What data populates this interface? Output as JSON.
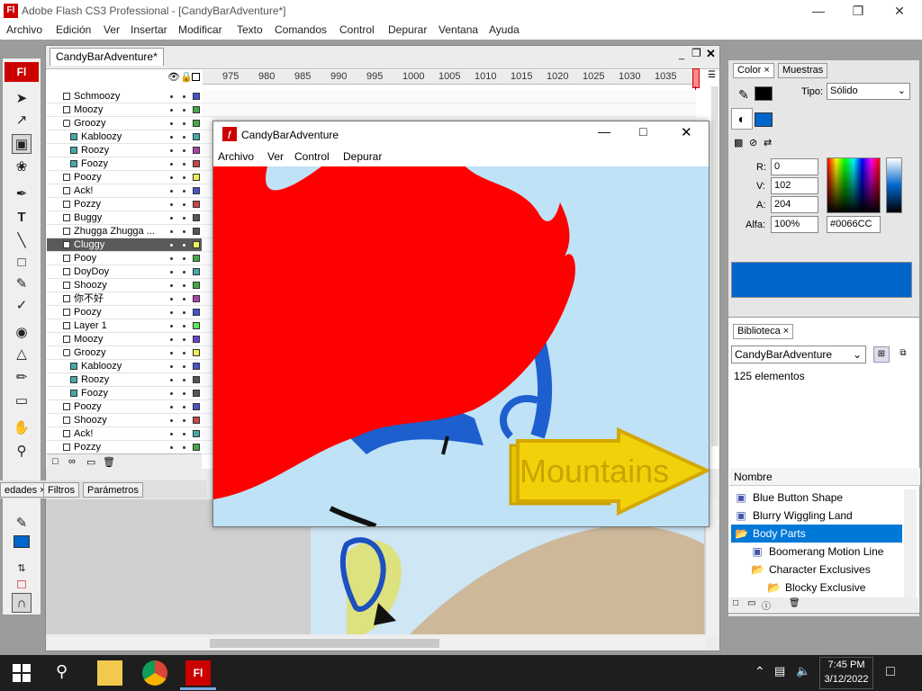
{
  "window": {
    "title": "Adobe Flash CS3 Professional - [CandyBarAdventure*]"
  },
  "menu": [
    "Archivo",
    "Edición",
    "Ver",
    "Insertar",
    "Modificar",
    "Texto",
    "Comandos",
    "Control",
    "Depurar",
    "Ventana",
    "Ayuda"
  ],
  "document": {
    "tab": "CandyBarAdventure*"
  },
  "ruler": [
    "975",
    "980",
    "985",
    "990",
    "995",
    "1000",
    "1005",
    "1010",
    "1015",
    "1020",
    "1025",
    "1030",
    "1035"
  ],
  "layers": [
    {
      "name": "Schmoozy",
      "type": "layer",
      "color": "#4455cc"
    },
    {
      "name": "Moozy",
      "type": "layer",
      "color": "#44aa44"
    },
    {
      "name": "Groozy",
      "type": "guide",
      "color": "#44aa44"
    },
    {
      "name": "Kabloozy",
      "type": "guided",
      "color": "#44aaaa"
    },
    {
      "name": "Roozy",
      "type": "guided",
      "color": "#aa44aa"
    },
    {
      "name": "Foozy",
      "type": "guided",
      "color": "#cc4444"
    },
    {
      "name": "Poozy",
      "type": "layer",
      "color": "#eeee55"
    },
    {
      "name": "Ack!",
      "type": "layer",
      "color": "#4455cc"
    },
    {
      "name": "Pozzy",
      "type": "layer",
      "color": "#cc4444"
    },
    {
      "name": "Buggy",
      "type": "layer",
      "color": "#555555"
    },
    {
      "name": "Zhugga Zhugga ...",
      "type": "layer",
      "color": "#555555"
    },
    {
      "name": "Cluggy",
      "type": "layer",
      "color": "#eeee55",
      "selected": true
    },
    {
      "name": "Pooy",
      "type": "layer",
      "color": "#44aa44"
    },
    {
      "name": "DoyDoy",
      "type": "layer",
      "color": "#44aaaa"
    },
    {
      "name": "Shoozy",
      "type": "layer",
      "color": "#44aa44"
    },
    {
      "name": "你不好",
      "type": "layer",
      "color": "#aa44aa"
    },
    {
      "name": "Poozy",
      "type": "layer",
      "color": "#4455cc"
    },
    {
      "name": "Layer 1",
      "type": "layer",
      "color": "#55ee55"
    },
    {
      "name": "Moozy",
      "type": "layer",
      "color": "#6644cc"
    },
    {
      "name": "Groozy",
      "type": "guide",
      "color": "#eeee55"
    },
    {
      "name": "Kabloozy",
      "type": "guided",
      "color": "#4455cc"
    },
    {
      "name": "Roozy",
      "type": "guided",
      "color": "#555555"
    },
    {
      "name": "Foozy",
      "type": "guided",
      "color": "#555555"
    },
    {
      "name": "Poozy",
      "type": "layer",
      "color": "#4455cc"
    },
    {
      "name": "Shoozy",
      "type": "layer",
      "color": "#cc4444"
    },
    {
      "name": "Ack!",
      "type": "layer",
      "color": "#44aaaa"
    },
    {
      "name": "Pozzy",
      "type": "layer",
      "color": "#44aa44"
    }
  ],
  "props_tabs": [
    "edades",
    "Filtros",
    "Parámetros"
  ],
  "color_panel": {
    "tabs": [
      "Color",
      "Muestras"
    ],
    "tipo_label": "Tipo:",
    "tipo_value": "Sólido",
    "r_label": "R:",
    "r": "0",
    "v_label": "V:",
    "v": "102",
    "a_label": "A:",
    "a": "204",
    "alfa_label": "Alfa:",
    "alfa": "100%",
    "hex": "#0066CC",
    "swatch": "#0066CC"
  },
  "library": {
    "tab": "Biblioteca",
    "doc": "CandyBarAdventure",
    "count": "125 elementos",
    "col": "Nombre",
    "items": [
      {
        "name": "Blue Button Shape",
        "kind": "symbol",
        "indent": 0
      },
      {
        "name": "Blurry Wiggling Land",
        "kind": "symbol",
        "indent": 0
      },
      {
        "name": "Body Parts",
        "kind": "folder",
        "indent": 0,
        "selected": true
      },
      {
        "name": "Boomerang Motion Line",
        "kind": "symbol",
        "indent": 1
      },
      {
        "name": "Character Exclusives",
        "kind": "folder",
        "indent": 1
      },
      {
        "name": "Blocky Exclusive",
        "kind": "folder",
        "indent": 2
      }
    ]
  },
  "player": {
    "title": "CandyBarAdventure",
    "menu": [
      "Archivo",
      "Ver",
      "Control",
      "Depurar"
    ],
    "sign_text": "Mountains"
  },
  "taskbar": {
    "time": "7:45 PM",
    "date": "3/12/2022"
  }
}
